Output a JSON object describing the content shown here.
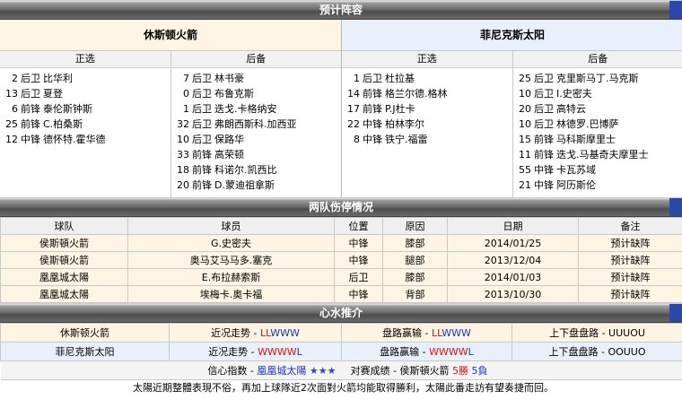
{
  "header": {
    "title": "预计阵容"
  },
  "home": {
    "name": "休斯顿火箭",
    "starters_label": "正选",
    "bench_label": "后备",
    "starters": [
      {
        "num": "2",
        "pos": "后卫",
        "name": "比华利"
      },
      {
        "num": "13",
        "pos": "后卫",
        "name": "夏登"
      },
      {
        "num": "6",
        "pos": "前锋",
        "name": "泰伦斯钟斯"
      },
      {
        "num": "25",
        "pos": "前锋",
        "name": "C.柏桑斯"
      },
      {
        "num": "12",
        "pos": "中锋",
        "name": "德怀特.霍华德"
      }
    ],
    "bench": [
      {
        "num": "7",
        "pos": "后卫",
        "name": "林书豪"
      },
      {
        "num": "0",
        "pos": "后卫",
        "name": "布鲁克斯"
      },
      {
        "num": "1",
        "pos": "后卫",
        "name": "迭戈.卡格纳安"
      },
      {
        "num": "32",
        "pos": "后卫",
        "name": "弗朗西斯科.加西亚"
      },
      {
        "num": "10",
        "pos": "后卫",
        "name": "保路华"
      },
      {
        "num": "33",
        "pos": "前锋",
        "name": "高荣顿"
      },
      {
        "num": "18",
        "pos": "前锋",
        "name": "科诺尔.凯西比"
      },
      {
        "num": "20",
        "pos": "前锋",
        "name": "D.蒙迪祖拿斯"
      }
    ]
  },
  "away": {
    "name": "菲尼克斯太阳",
    "starters_label": "正选",
    "bench_label": "后备",
    "starters": [
      {
        "num": "1",
        "pos": "后卫",
        "name": "杜拉基"
      },
      {
        "num": "14",
        "pos": "前锋",
        "name": "格兰尔德.格林"
      },
      {
        "num": "17",
        "pos": "前锋",
        "name": "P.J杜卡"
      },
      {
        "num": "22",
        "pos": "中锋",
        "name": "柏林李尔"
      },
      {
        "num": "8",
        "pos": "中锋",
        "name": "铁宁.福雷"
      }
    ],
    "bench": [
      {
        "num": "25",
        "pos": "后卫",
        "name": "克里斯马丁.马克斯"
      },
      {
        "num": "10",
        "pos": "后卫",
        "name": "I.史密夫"
      },
      {
        "num": "20",
        "pos": "后卫",
        "name": "高特云"
      },
      {
        "num": "10",
        "pos": "后卫",
        "name": "林德罗.巴博萨"
      },
      {
        "num": "15",
        "pos": "前锋",
        "name": "马科斯摩里士"
      },
      {
        "num": "11",
        "pos": "前锋",
        "name": "迭戈.马基奇夫摩里士"
      },
      {
        "num": "55",
        "pos": "中锋",
        "name": "卡瓦苏域"
      },
      {
        "num": "21",
        "pos": "中锋",
        "name": "阿历斯伦"
      }
    ]
  },
  "injuries": {
    "title": "两队伤停情况",
    "headers": [
      "球队",
      "球员",
      "位置",
      "原因",
      "日期",
      "备注"
    ],
    "rows": [
      [
        "侯斯頓火箭",
        "G.史密夫",
        "中锋",
        "膝部",
        "2014/01/25",
        "预计缺阵"
      ],
      [
        "侯斯頓火箭",
        "奥马艾马马多.塞克",
        "中锋",
        "腿部",
        "2013/12/04",
        "预计缺阵"
      ],
      [
        "凰凰城太陽",
        "E.布拉赫索斯",
        "后卫",
        "膝部",
        "2014/01/03",
        "预计缺阵"
      ],
      [
        "凰凰城太陽",
        "埃梅卡.奥卡福",
        "中锋",
        "背部",
        "2013/10/30",
        "预计缺阵"
      ]
    ]
  },
  "tips": {
    "title": "心水推介",
    "rows": [
      {
        "team": "休斯顿火箭",
        "recent_label": "近况走势 - ",
        "recent_a": "LL",
        "recent_b": "WWW",
        "handicap_label": "盘路赢输 - ",
        "handicap_a": "LL",
        "handicap_b": "WWW",
        "ou_label": "上下盘盘路 - ",
        "ou_value": "UUUOU"
      },
      {
        "team": "菲尼克斯太阳",
        "recent_label": "近况走势 - ",
        "recent_a": "WWWW",
        "recent_b": "L",
        "handicap_label": "盘路赢输 - ",
        "handicap_a": "WWWW",
        "handicap_b": "L",
        "ou_label": "上下盘盘路 - ",
        "ou_value": "OOUUO"
      }
    ],
    "confidence_label": "信心指数 - ",
    "confidence_team": "凰凰城太陽",
    "confidence_stars": "★★★",
    "h2h_label": "对赛成绩 - 侯斯頓火箭 ",
    "h2h_wins": "5勝",
    "h2h_space": " ",
    "h2h_losses": "5負",
    "summary": "太陽近期整體表現不俗，再加上球隊近2次面對火箭均能取得勝利，太陽此番走訪有望奏捷而回。"
  },
  "colors": {
    "win": "#e01010",
    "loss": "#1a33c8",
    "bar_accent": "#2b47a8"
  }
}
